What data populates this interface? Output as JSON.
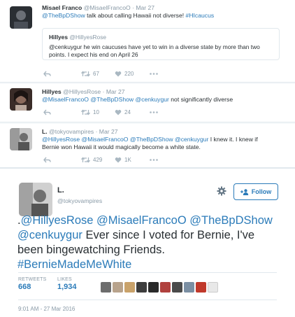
{
  "tweet1": {
    "name": "Misael Franco",
    "handle": "@MisaelFrancoO",
    "date": "· Mar 27",
    "mention": "@TheBpDShow",
    "text": " talk about calling Hawaii not diverse! ",
    "hashtag": "#HIcaucus",
    "quote": {
      "name": "Hillyes",
      "handle": "@HillyesRose",
      "text": "@cenkuygur he win caucuses have yet to win in a diverse state by more than two points. I expect his end on April 26"
    },
    "retweets": "67",
    "likes": "220"
  },
  "tweet2": {
    "name": "Hillyes",
    "handle": "@HillyesRose",
    "date": "· Mar 27",
    "mentions": "@MisaelFrancoO @TheBpDShow @cenkuygur",
    "text": " not significantly diverse",
    "retweets": "10",
    "likes": "24"
  },
  "tweet3": {
    "name": "L.",
    "handle": "@tokyovampires",
    "date": "· Mar 27",
    "mentions": "@HillyesRose @MisaelFrancoO @TheBpDShow @cenkuygur",
    "text_line1_rest": " I knew it. I knew if",
    "text_line2": "Bernie won Hawaii it would magically become a white state.",
    "retweets": "429",
    "likes": "1K"
  },
  "main": {
    "name": "L.",
    "handle": "@tokyovampires",
    "follow_label": "Follow",
    "text_prefix": ".",
    "mentions_line1": "@HillyesRose @MisaelFrancoO @TheBpDShow",
    "mention_line2": "@cenkuygur",
    "text_rest": " Ever since I voted for Bernie, I've been bingewatching Friends.",
    "hashtag": "#BernieMadeMeWhite",
    "retweets_label": "RETWEETS",
    "retweets": "668",
    "likes_label": "LIKES",
    "likes": "1,934",
    "timestamp": "9:01 AM - 27 Mar 2016"
  },
  "icons": {
    "reply": "reply-icon",
    "retweet": "retweet-icon",
    "like": "heart-icon",
    "more": "more-icon",
    "gear": "gear-icon",
    "follow": "add-user-icon"
  },
  "colors": {
    "link": "#2b7bb9",
    "muted": "#8899a6",
    "text": "#292f33",
    "like": "#e81c4f"
  }
}
